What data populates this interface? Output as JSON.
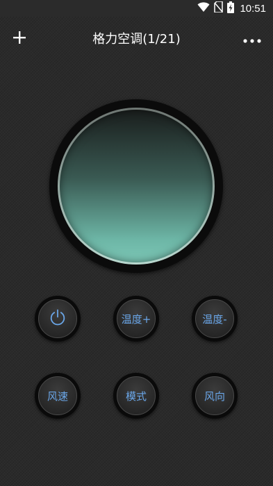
{
  "status_bar": {
    "time": "10:51",
    "icons": [
      "wifi-icon",
      "no-sim-icon",
      "battery-charging-icon"
    ]
  },
  "header": {
    "title": "格力空调(1/21)",
    "add_icon": "plus-icon",
    "more_icon": "more-horizontal-icon"
  },
  "dial": {
    "accent_top": "#1a1e1d",
    "accent_bottom": "#7cc7b6"
  },
  "controls": {
    "power": {
      "icon": "power-icon"
    },
    "temp_up": {
      "label": "温度+"
    },
    "temp_down": {
      "label": "温度-"
    },
    "fan_speed": {
      "label": "风速"
    },
    "mode": {
      "label": "模式"
    },
    "wind_direction": {
      "label": "风向"
    }
  },
  "colors": {
    "background": "#2a2a2a",
    "button_label": "#6aa6e8",
    "title": "#ffffff"
  }
}
